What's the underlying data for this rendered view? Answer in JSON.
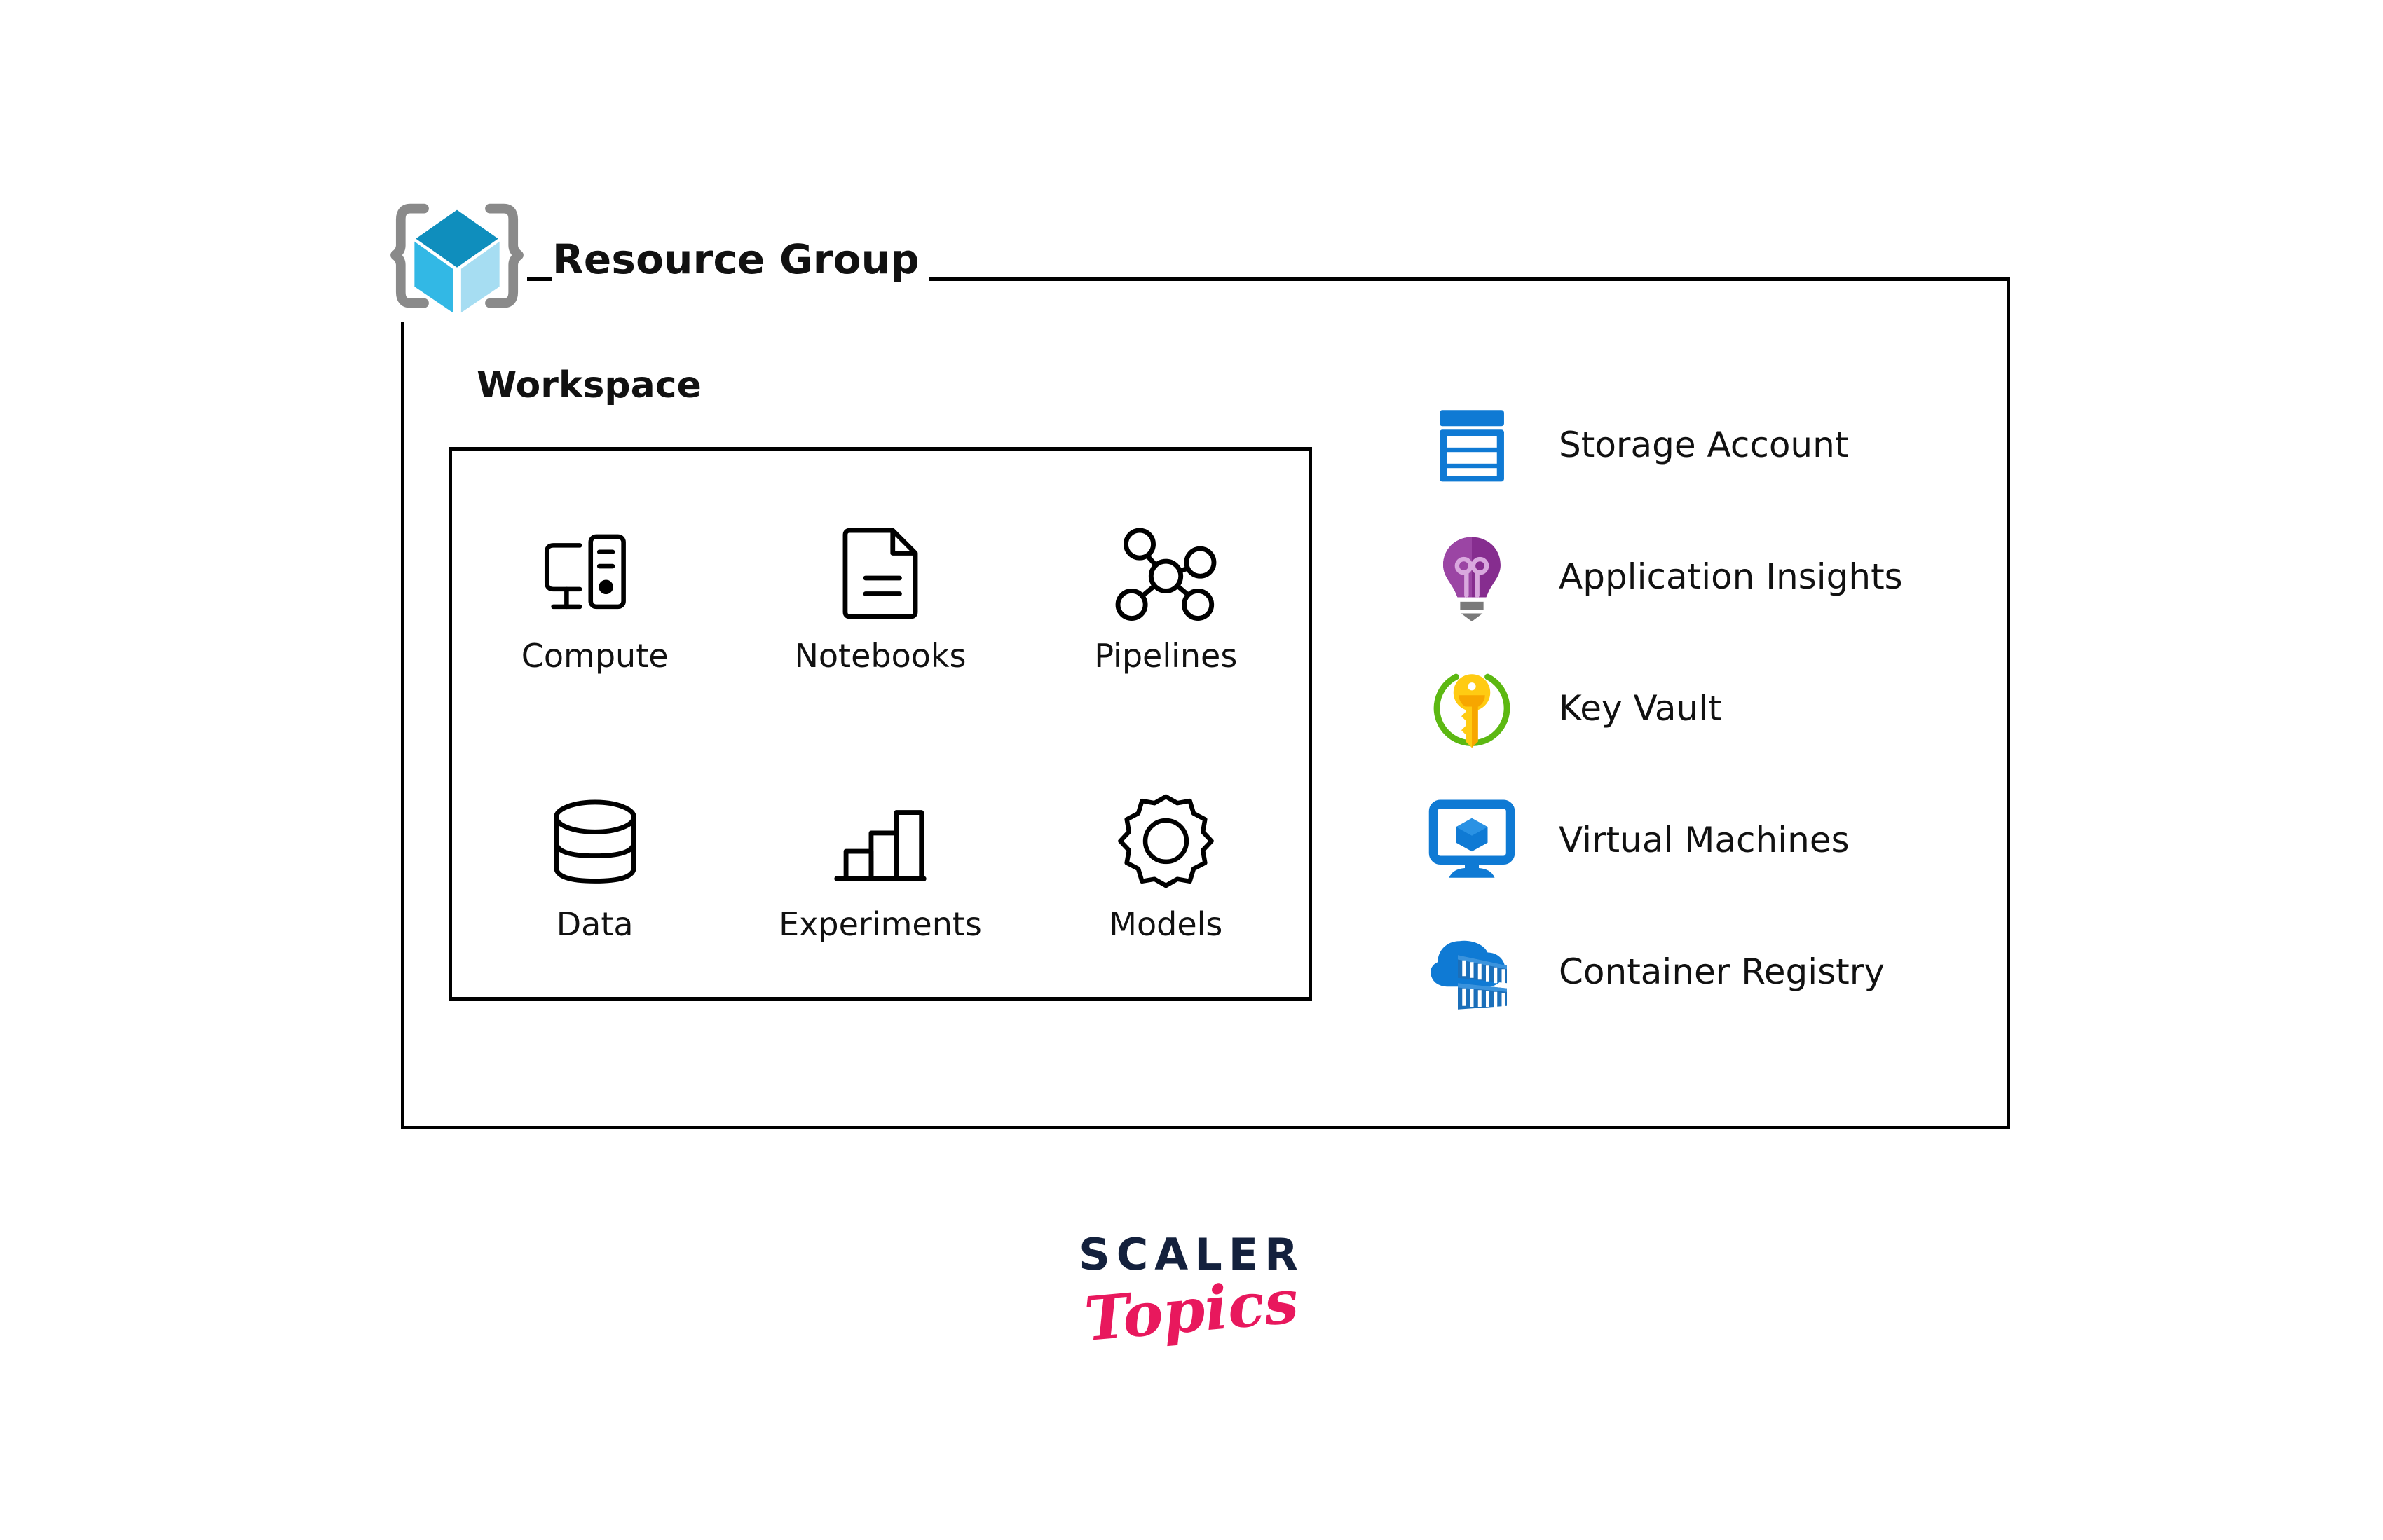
{
  "diagram": {
    "resource_group": {
      "title": "Resource Group",
      "icon": "resource-group-cube-icon"
    },
    "workspace": {
      "title": "Workspace",
      "items": [
        {
          "label": "Compute",
          "icon": "computer-desktop-icon"
        },
        {
          "label": "Notebooks",
          "icon": "document-page-icon"
        },
        {
          "label": "Pipelines",
          "icon": "network-graph-icon"
        },
        {
          "label": "Data",
          "icon": "database-cylinder-icon"
        },
        {
          "label": "Experiments",
          "icon": "bar-chart-icon"
        },
        {
          "label": "Models",
          "icon": "gear-icon"
        }
      ]
    },
    "services": [
      {
        "label": "Storage Account",
        "icon": "storage-account-icon",
        "color": "#0078d4"
      },
      {
        "label": "Application Insights",
        "icon": "lightbulb-icon",
        "color": "#8c1a9b"
      },
      {
        "label": "Key Vault",
        "icon": "key-vault-icon",
        "color": "#ffca00"
      },
      {
        "label": "Virtual Machines",
        "icon": "virtual-machine-icon",
        "color": "#0f7ad4"
      },
      {
        "label": "Container Registry",
        "icon": "container-registry-icon",
        "color": "#0f7ad4"
      }
    ]
  },
  "logo": {
    "primary": "SCALER",
    "secondary": "Topics",
    "primary_color": "#14213d",
    "secondary_color": "#e8185d"
  }
}
